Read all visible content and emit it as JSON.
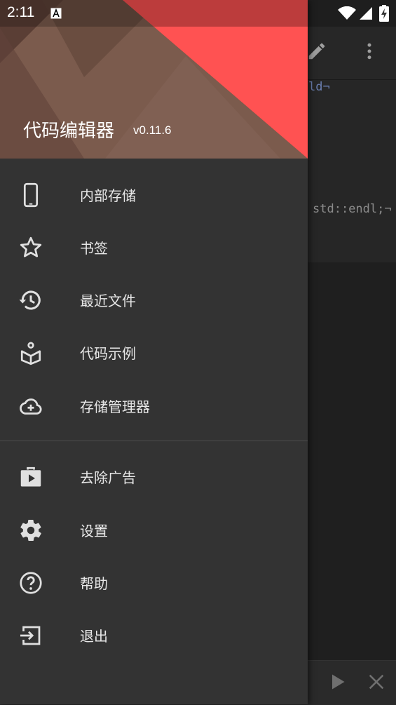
{
  "status_bar": {
    "time": "2:11"
  },
  "header": {
    "app_name": "代码编辑器",
    "version": "v0.11.6"
  },
  "background_editor": {
    "code_fragments": [
      "ld¬",
      "std::endl;¬"
    ]
  },
  "menu": {
    "primary": [
      {
        "label": "内部存储",
        "icon": "phone-icon"
      },
      {
        "label": "书签",
        "icon": "star-icon"
      },
      {
        "label": "最近文件",
        "icon": "history-icon"
      },
      {
        "label": "代码示例",
        "icon": "book-icon"
      },
      {
        "label": "存储管理器",
        "icon": "cloud-add-icon"
      }
    ],
    "secondary": [
      {
        "label": "去除广告",
        "icon": "play-bag-icon"
      },
      {
        "label": "设置",
        "icon": "gear-icon"
      },
      {
        "label": "帮助",
        "icon": "help-icon"
      },
      {
        "label": "退出",
        "icon": "exit-icon"
      }
    ]
  },
  "colors": {
    "accent": "#ff5252",
    "drawer_bg": "#333333",
    "header_brown": "#7a5a4c"
  }
}
